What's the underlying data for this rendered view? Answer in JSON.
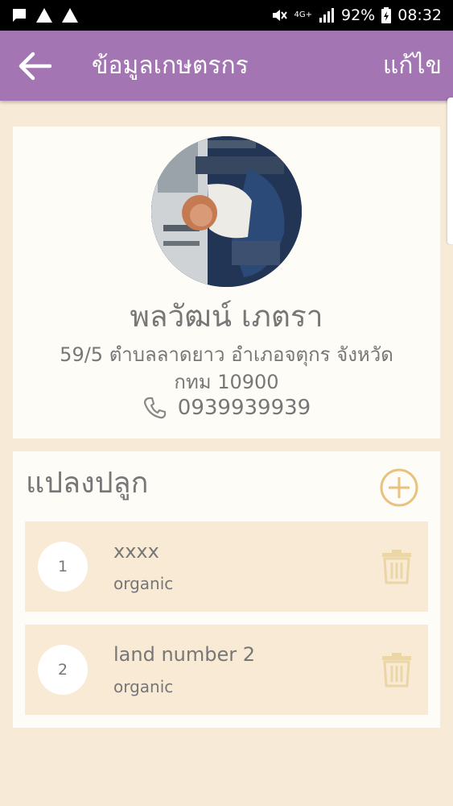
{
  "status_bar": {
    "battery": "92%",
    "time": "08:32",
    "network": "4G+"
  },
  "header": {
    "title": "ข้อมูลเกษตรกร",
    "edit_label": "แก้ไข"
  },
  "profile": {
    "name": "พลวัฒน์ เภตรา",
    "address": "59/5 ตำบลลาดยาว อำเภอจตุกร จังหวัดกทม 10900",
    "phone": "0939939939"
  },
  "plots": {
    "title": "แปลงปลูก",
    "items": [
      {
        "number": "1",
        "name": "xxxx",
        "type": "organic"
      },
      {
        "number": "2",
        "name": "land number 2",
        "type": "organic"
      }
    ]
  },
  "colors": {
    "header": "#a375b2",
    "background": "#f7ebd8",
    "accent": "#e8c27e",
    "card": "#fefcf7",
    "item": "#f8ead4"
  }
}
